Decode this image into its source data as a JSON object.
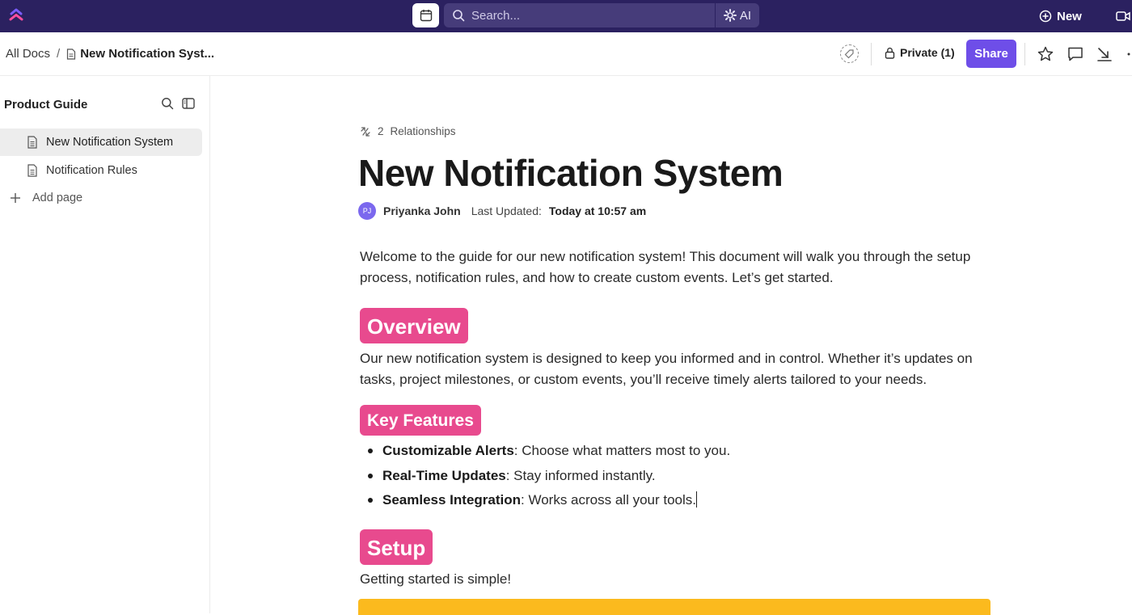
{
  "topbar": {
    "search_placeholder": "Search...",
    "ai_label": "AI",
    "new_label": "New"
  },
  "subheader": {
    "breadcrumb": {
      "root": "All Docs",
      "separator": "/",
      "current": "New Notification Syst..."
    },
    "private_label": "Private (1)",
    "share_label": "Share"
  },
  "sidebar": {
    "title": "Product Guide",
    "pages": [
      {
        "label": "New Notification System",
        "active": true
      },
      {
        "label": "Notification Rules",
        "active": false
      }
    ],
    "add_page_label": "Add page"
  },
  "document": {
    "relationships_count": "2",
    "relationships_label": "Relationships",
    "title": "New Notification System",
    "author_initials": "PJ",
    "author": "Priyanka John",
    "updated_label": "Last Updated:",
    "updated_value": "Today at 10:57 am",
    "intro": "Welcome to the guide for our new notification system! This document will walk you through the setup process, notification rules, and how to create custom events. Let’s get started.",
    "overview_heading": "Overview",
    "overview_text": "Our new notification system is designed to keep you informed and in control. Whether it’s updates on tasks, project milestones, or custom events, you’ll receive timely alerts tailored to your needs.",
    "features_heading": "Key Features",
    "features": [
      {
        "title": "Customizable Alerts",
        "text": ": Choose what matters most to you."
      },
      {
        "title": "Real-Time Updates",
        "text": ": Stay informed instantly."
      },
      {
        "title": "Seamless Integration",
        "text": ": Works across all your tools."
      }
    ],
    "setup_heading": "Setup",
    "setup_text": "Getting started is simple!"
  },
  "colors": {
    "topbar_bg": "#2b2160",
    "share_button": "#6e4ee8",
    "heading_badge": "#e84a8e",
    "avatar": "#7b68ee",
    "callout": "#fbba1e"
  }
}
